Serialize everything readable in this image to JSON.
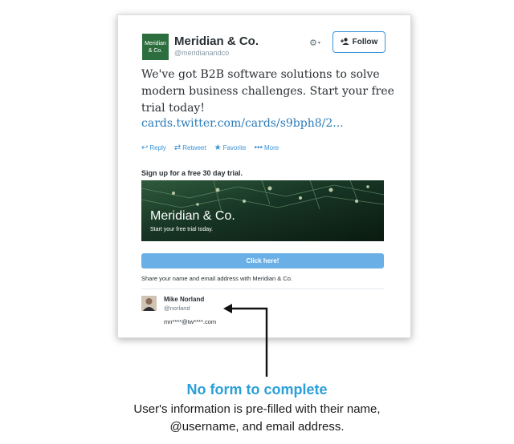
{
  "tweet": {
    "account": {
      "avatar_text_line1": "Meridian",
      "avatar_text_line2": "& Co.",
      "name": "Meridian & Co.",
      "handle": "@meridianandco"
    },
    "follow_label": "Follow",
    "text": "We've got B2B software solutions to solve modern business challenges. Start your free trial today!",
    "link": "cards.twitter.com/cards/s9bph8/2...",
    "actions": {
      "reply": "Reply",
      "retweet": "Retweet",
      "favorite": "Favorite",
      "more": "More"
    }
  },
  "lead_card": {
    "headline": "Sign up for a free 30 day trial.",
    "banner_title": "Meridian & Co.",
    "banner_subtitle": "Start your free trial today.",
    "cta_label": "Click here!",
    "share_text": "Share your name and email address with Meridian & Co.",
    "user": {
      "name": "Mike Norland",
      "handle": "@norland",
      "email": "mn****@tw****.com"
    }
  },
  "caption": {
    "title": "No form to complete",
    "body_line1": "User's information is pre-filled with their name,",
    "body_line2": "@username, and email address."
  },
  "colors": {
    "accent": "#2a9fd8",
    "link": "#2b7bb9",
    "cta": "#6ab0e6",
    "brand_green": "#2d6e3e"
  },
  "icons": {
    "settings": "gear-icon",
    "follow": "add-person-icon",
    "reply": "reply-icon",
    "retweet": "retweet-icon",
    "favorite": "star-icon",
    "more": "ellipsis-icon"
  }
}
